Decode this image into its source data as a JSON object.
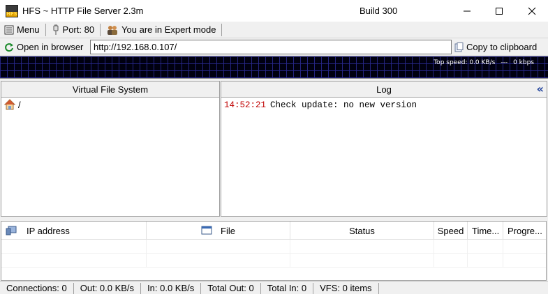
{
  "window": {
    "title": "HFS ~ HTTP File Server 2.3m",
    "build": "Build 300",
    "icon_text": "HFS"
  },
  "toolbar": {
    "menu_label": "Menu",
    "port_label": "Port: 80",
    "mode_label": "You are in Expert mode"
  },
  "address_bar": {
    "open_label": "Open in browser",
    "url": "http://192.168.0.107/",
    "copy_label": "Copy to clipboard"
  },
  "graph": {
    "top_speed": "Top speed: 0.0 KB/s",
    "separator": "---",
    "kbps": "0 kbps"
  },
  "vfs": {
    "title": "Virtual File System",
    "root": "/"
  },
  "log": {
    "title": "Log",
    "collapse_glyph": "«",
    "entries": [
      {
        "time": "14:52:21",
        "message": "Check update: no new version"
      }
    ]
  },
  "connections": {
    "columns": [
      "IP address",
      "File",
      "Status",
      "Speed",
      "Time...",
      "Progre..."
    ]
  },
  "statusbar": {
    "connections": "Connections: 0",
    "out": "Out: 0.0 KB/s",
    "in": "In: 0.0 KB/s",
    "total_out": "Total Out: 0",
    "total_in": "Total In: 0",
    "vfs": "VFS: 0 items"
  },
  "colors": {
    "log_time": "#c00000",
    "graph_bg": "#000010",
    "grid": "#28288c",
    "accent_blue": "#1a3d9a"
  }
}
